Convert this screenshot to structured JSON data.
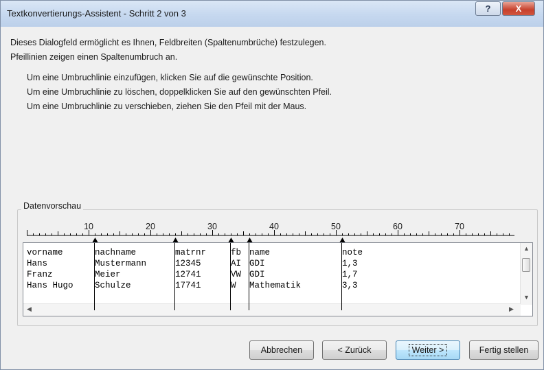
{
  "window": {
    "title": "Textkonvertierungs-Assistent - Schritt 2 von 3",
    "help_label": "?",
    "close_label": "X"
  },
  "description": {
    "line1": "Dieses Dialogfeld ermöglicht es Ihnen, Feldbreiten (Spaltenumbrüche) festzulegen.",
    "line2": "Pfeillinien zeigen einen Spaltenumbruch an."
  },
  "hints": [
    "Um eine Umbruchlinie einzufügen, klicken Sie auf die gewünschte Position.",
    "Um eine Umbruchlinie zu löschen, doppelklicken Sie auf den gewünschten Pfeil.",
    "Um eine Umbruchlinie zu verschieben, ziehen Sie den Pfeil mit der Maus."
  ],
  "preview": {
    "label": "Datenvorschau",
    "ruler_numbers": [
      "10",
      "20",
      "30",
      "40",
      "50",
      "60",
      "70"
    ],
    "column_breaks": [
      11,
      24,
      33,
      36,
      51
    ],
    "rows": [
      [
        "vorname",
        "nachname",
        "matrnr",
        "fb",
        "name",
        "note"
      ],
      [
        "Hans",
        "Mustermann",
        "12345",
        "AI",
        "GDI",
        "1,3"
      ],
      [
        "Franz",
        "Meier",
        "12741",
        "VW",
        "GDI",
        "1,7"
      ],
      [
        "Hans Hugo",
        "Schulze",
        "17741",
        "W",
        "Mathematik",
        "3,3"
      ]
    ]
  },
  "buttons": {
    "cancel": "Abbrechen",
    "back": "< Zurück",
    "next": "Weiter >",
    "finish": "Fertig stellen"
  }
}
